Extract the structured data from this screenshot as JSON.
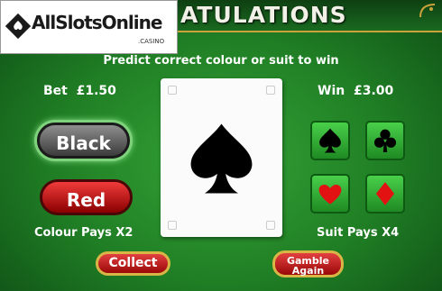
{
  "banner": {
    "title_fragment": "ATULATIONS"
  },
  "logo": {
    "text": "AllSlotsOnline",
    "subtext": ".CASINO"
  },
  "instruction": "Predict correct colour or suit to win",
  "bet": {
    "label": "Bet",
    "value": "£1.50"
  },
  "win": {
    "label": "Win",
    "value": "£3.00"
  },
  "card": {
    "suit_icon": "spade-icon",
    "color": "#000000"
  },
  "colour_buttons": [
    {
      "label": "Black",
      "color": "#3b3b3b",
      "selected": true
    },
    {
      "label": "Red",
      "color": "#c21010",
      "selected": false
    }
  ],
  "colour_pays": "Colour Pays X2",
  "suit_buttons": [
    {
      "icon": "spade-icon",
      "color": "#000000"
    },
    {
      "icon": "club-icon",
      "color": "#000000"
    },
    {
      "icon": "heart-icon",
      "color": "#e21212"
    },
    {
      "icon": "diamond-icon",
      "color": "#e21212"
    }
  ],
  "suit_pays": "Suit Pays X4",
  "collect_label": "Collect",
  "gamble_label_line1": "Gamble",
  "gamble_label_line2": "Again",
  "colors": {
    "table": "#1f7d24",
    "gold": "#d8b646",
    "red_button": "#c21010"
  }
}
